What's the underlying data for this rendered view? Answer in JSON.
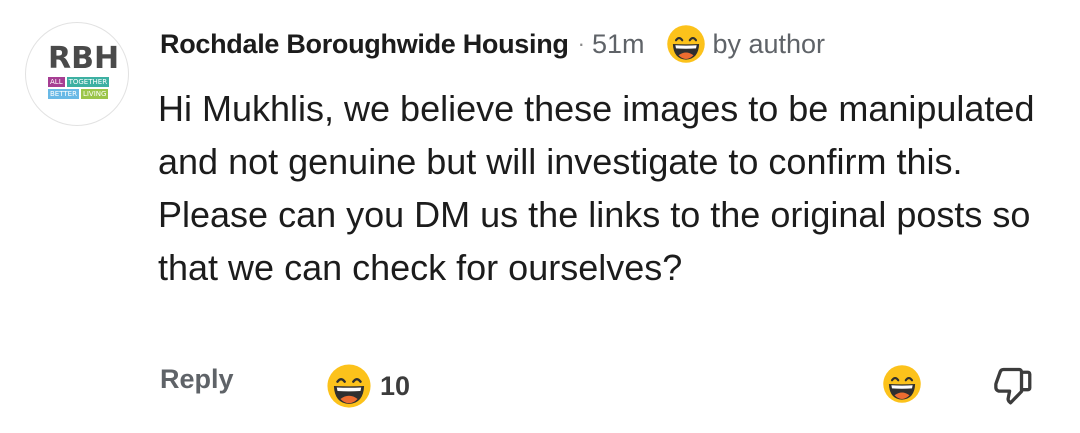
{
  "comment": {
    "avatar": {
      "logo_letters": "RBH",
      "tagline_row1": [
        "ALL",
        "TOGETHER"
      ],
      "tagline_row2": [
        "BETTER",
        "LIVING"
      ],
      "tagline_colors": [
        "#a63e93",
        "#3db0a2",
        "#69b9e6",
        "#9bc54a"
      ],
      "letters_color": "#4a4a4a"
    },
    "author": "Rochdale Boroughwide Housing",
    "separator": "·",
    "time": "51m",
    "author_badge_icon": "grinning-face-emoji",
    "author_badge_label": "by author",
    "text": "Hi Mukhlis, we believe these images to be manipulated and not genuine but will investigate to confirm this. Please can you DM us the links to the original posts so that we can check for ourselves?",
    "actions": {
      "reply_label": "Reply",
      "reaction_icon": "grinning-face-emoji",
      "reaction_count": "10",
      "add_reaction_icon": "grinning-face-emoji",
      "dislike_icon": "thumbs-down-icon"
    },
    "colors": {
      "emoji_face": "#fcc21b",
      "emoji_mouth": "#2f2f2f",
      "emoji_tongue": "#ed6c30",
      "secondary_text": "#5f6368"
    }
  }
}
